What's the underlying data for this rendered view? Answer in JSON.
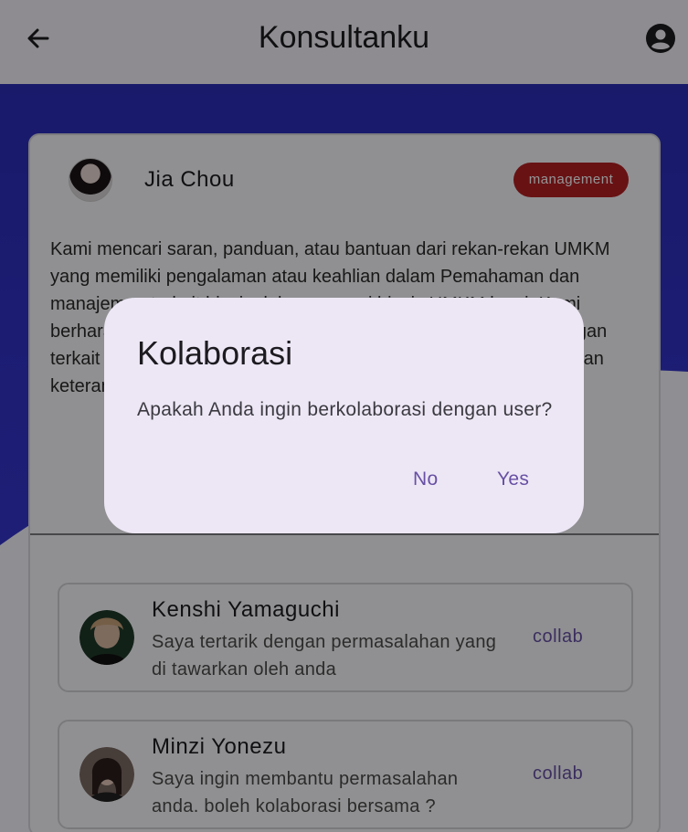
{
  "appbar": {
    "title": "Konsultanku",
    "back_icon": "arrow-left-icon",
    "account_icon": "account-circle-icon"
  },
  "post": {
    "owner_name": "Jia Chou",
    "category_badge": "management",
    "description": "Kami mencari saran, panduan, atau bantuan dari rekan-rekan UMKM yang memiliki pengalaman atau keahlian dalam Pemahaman dan manajemen terkait bisnis dalam operasi bisnis UMKM kami. Kami berharap kerja sama dapat membantu dalam menghadapi tantangan terkait pengelolaan sumber daya yang kami miliki dan meningkatkan keterampilan teknologi kami.",
    "action_partial": "r",
    "badge_color": "#b31f24"
  },
  "replies": [
    {
      "name": "Kenshi Yamaguchi",
      "message": "Saya tertarik dengan permasalahan yang di tawarkan oleh anda",
      "button": "collab"
    },
    {
      "name": "Minzi Yonezu",
      "message": "Saya ingin membantu permasalahan anda. boleh kolaborasi bersama ?",
      "button": "collab"
    }
  ],
  "dialog": {
    "title": "Kolaborasi",
    "body": "Apakah Anda ingin berkolaborasi dengan user?",
    "no_label": "No",
    "yes_label": "Yes"
  },
  "colors": {
    "accent": "#6750a4",
    "header_blue": "#3232c9"
  }
}
